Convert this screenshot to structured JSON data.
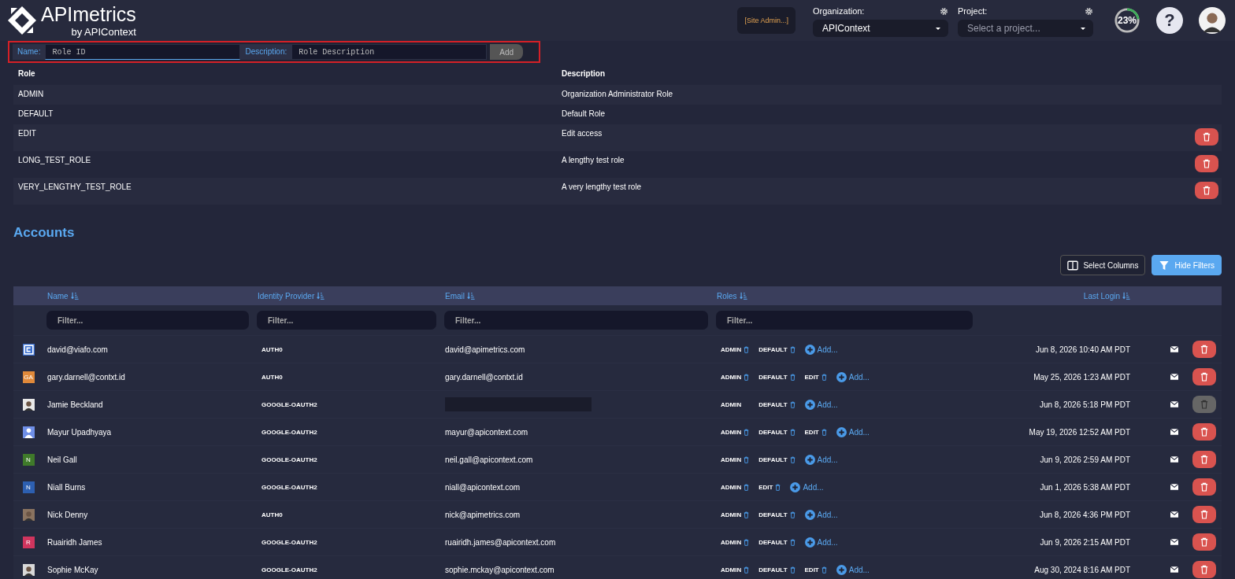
{
  "header": {
    "brand": "APImetrics",
    "brand_sub": "by APIContext",
    "site_admin": "[Site Admin...]",
    "organization": {
      "label": "Organization:",
      "value": "APIContext"
    },
    "project": {
      "label": "Project:",
      "placeholder": "Select a project..."
    },
    "progress": {
      "level": 0.23,
      "reading": "23%"
    },
    "help": "?"
  },
  "role_form": {
    "name_label": "Name:",
    "name_placeholder": "Role ID",
    "description_label": "Description:",
    "description_placeholder": "Role Description",
    "add_button": "Add"
  },
  "roles_table": {
    "columns": [
      "Role",
      "Description"
    ],
    "rows": [
      {
        "role": "ADMIN",
        "description": "Organization Administrator Role",
        "deletable": false
      },
      {
        "role": "DEFAULT",
        "description": "Default Role",
        "deletable": false
      },
      {
        "role": "EDIT",
        "description": "Edit access",
        "deletable": true
      },
      {
        "role": "LONG_TEST_ROLE",
        "description": "A lengthy test role",
        "deletable": true
      },
      {
        "role": "VERY_LENGTHY_TEST_ROLE",
        "description": "A very lengthy test role",
        "deletable": true
      }
    ]
  },
  "accounts": {
    "title": "Accounts",
    "select_columns": "Select Columns",
    "hide_filters": "Hide Filters",
    "columns": [
      {
        "label": "Name",
        "filter_placeholder": "Filter..."
      },
      {
        "label": "Identity Provider",
        "filter_placeholder": "Filter..."
      },
      {
        "label": "Email",
        "filter_placeholder": "Filter..."
      },
      {
        "label": "Roles",
        "filter_placeholder": "Filter..."
      },
      {
        "label": "Last Login"
      }
    ],
    "rows": [
      {
        "avatar": {
          "kind": "logo",
          "color": "#3a6fd0"
        },
        "name": "david@viafo.com",
        "provider": "AUTH0",
        "email": "david@apimetrics.com",
        "roles": [
          {
            "name": "ADMIN",
            "removable": true
          },
          {
            "name": "DEFAULT",
            "removable": true
          }
        ],
        "add_label": "Add...",
        "last_login": "Jun 8, 2026 10:40 AM PDT",
        "delete_enabled": true
      },
      {
        "avatar": {
          "kind": "letter",
          "letter": "GA",
          "color": "#e0893a"
        },
        "name": "gary.darnell@contxt.id",
        "provider": "AUTH0",
        "email": "gary.darnell@contxt.id",
        "roles": [
          {
            "name": "ADMIN",
            "removable": true
          },
          {
            "name": "DEFAULT",
            "removable": true
          },
          {
            "name": "EDIT",
            "removable": true
          }
        ],
        "add_label": "Add...",
        "last_login": "May 25, 2026 1:23 AM PDT",
        "delete_enabled": true
      },
      {
        "avatar": {
          "kind": "photo",
          "color": "#e8e8e8"
        },
        "name": "Jamie Beckland",
        "provider": "GOOGLE-OAUTH2",
        "redacted_email": true,
        "roles": [
          {
            "name": "ADMIN",
            "removable": false
          },
          {
            "name": "DEFAULT",
            "removable": true
          }
        ],
        "add_label": "Add...",
        "last_login": "Jun 8, 2026 5:18 PM PDT",
        "delete_enabled": false
      },
      {
        "avatar": {
          "kind": "person",
          "color": "#6f8fe8"
        },
        "name": "Mayur Upadhyaya",
        "provider": "GOOGLE-OAUTH2",
        "email": "mayur@apicontext.com",
        "roles": [
          {
            "name": "ADMIN",
            "removable": true
          },
          {
            "name": "DEFAULT",
            "removable": true
          },
          {
            "name": "EDIT",
            "removable": true
          }
        ],
        "add_label": "Add...",
        "last_login": "May 19, 2026 12:52 AM PDT",
        "delete_enabled": true
      },
      {
        "avatar": {
          "kind": "letter",
          "letter": "N",
          "color": "#3f7a2a"
        },
        "name": "Neil Gall",
        "provider": "GOOGLE-OAUTH2",
        "email": "neil.gall@apicontext.com",
        "roles": [
          {
            "name": "ADMIN",
            "removable": true
          },
          {
            "name": "DEFAULT",
            "removable": true
          }
        ],
        "add_label": "Add...",
        "last_login": "Jun 9, 2026 2:59 AM PDT",
        "delete_enabled": true
      },
      {
        "avatar": {
          "kind": "letter",
          "letter": "N",
          "color": "#2d5fb0"
        },
        "name": "Niall Burns",
        "provider": "GOOGLE-OAUTH2",
        "email": "niall@apicontext.com",
        "roles": [
          {
            "name": "ADMIN",
            "removable": true
          },
          {
            "name": "EDIT",
            "removable": true
          }
        ],
        "add_label": "Add...",
        "last_login": "Jun 1, 2026 5:38 AM PDT",
        "delete_enabled": true
      },
      {
        "avatar": {
          "kind": "photo",
          "color": "#8a7360"
        },
        "name": "Nick Denny",
        "provider": "AUTH0",
        "email": "nick@apimetrics.com",
        "roles": [
          {
            "name": "ADMIN",
            "removable": true
          },
          {
            "name": "DEFAULT",
            "removable": true
          }
        ],
        "add_label": "Add...",
        "last_login": "Jun 8, 2026 4:36 PM PDT",
        "delete_enabled": true
      },
      {
        "avatar": {
          "kind": "letter",
          "letter": "R",
          "color": "#d0355e"
        },
        "name": "Ruairidh James",
        "provider": "GOOGLE-OAUTH2",
        "email": "ruairidh.james@apicontext.com",
        "roles": [
          {
            "name": "ADMIN",
            "removable": true
          },
          {
            "name": "DEFAULT",
            "removable": true
          }
        ],
        "add_label": "Add...",
        "last_login": "Jun 9, 2026 2:15 AM PDT",
        "delete_enabled": true
      },
      {
        "avatar": {
          "kind": "photo",
          "color": "#d8d8d8"
        },
        "name": "Sophie McKay",
        "provider": "GOOGLE-OAUTH2",
        "email": "sophie.mckay@apicontext.com",
        "roles": [
          {
            "name": "ADMIN",
            "removable": true
          },
          {
            "name": "DEFAULT",
            "removable": true
          },
          {
            "name": "EDIT",
            "removable": true
          }
        ],
        "add_label": "Add...",
        "last_login": "Aug 30, 2024 8:16 AM PDT",
        "delete_enabled": true
      }
    ]
  }
}
